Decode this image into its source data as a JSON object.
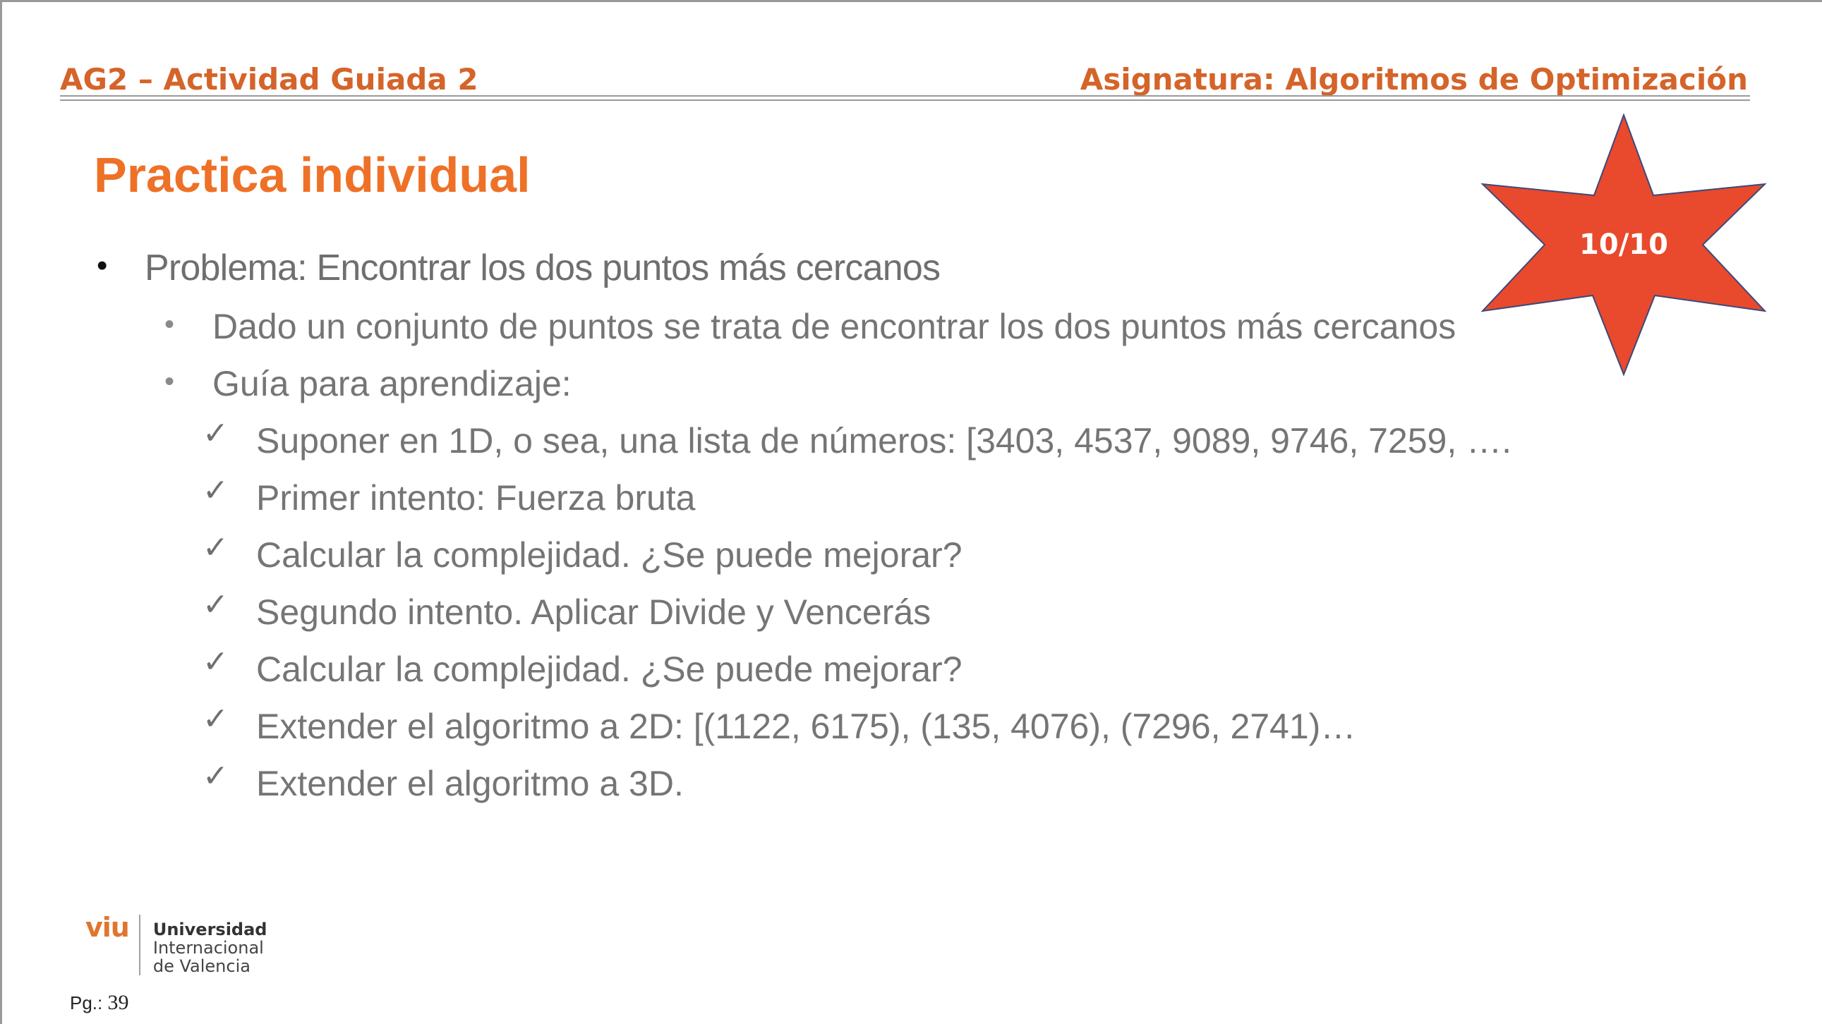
{
  "header": {
    "left": "AG2 – Actividad Guiada 2",
    "right": "Asignatura: Algoritmos de Optimización"
  },
  "title": "Practica individual",
  "badge": {
    "label": "10/10",
    "fill_color": "#e9492c",
    "stroke_color": "#3b4a7a"
  },
  "content": {
    "level1": {
      "bullet": "•",
      "text": "Problema: Encontrar los dos puntos más cercanos"
    },
    "level2": [
      {
        "bullet": "•",
        "text": "Dado un conjunto de puntos se trata de encontrar los dos puntos más cercanos"
      },
      {
        "bullet": "•",
        "text": "Guía para aprendizaje:"
      }
    ],
    "checks": [
      {
        "mark": "✓",
        "text": "Suponer en 1D, o sea, una lista de números: [3403, 4537, 9089, 9746, 7259, …."
      },
      {
        "mark": "✓",
        "text": "Primer intento: Fuerza bruta"
      },
      {
        "mark": "✓",
        "text": "Calcular la complejidad. ¿Se puede mejorar?"
      },
      {
        "mark": "✓",
        "text": "Segundo intento. Aplicar Divide y Vencerás"
      },
      {
        "mark": "✓",
        "text": "Calcular la complejidad. ¿Se puede mejorar?"
      },
      {
        "mark": "✓",
        "text": "Extender el algoritmo a 2D: [(1122, 6175), (135, 4076), (7296, 2741)…"
      },
      {
        "mark": "✓",
        "text": "Extender el algoritmo a 3D."
      }
    ]
  },
  "footer": {
    "logo_mark": "viu",
    "logo_line1": "Universidad",
    "logo_line2": "Internacional",
    "logo_line3": "de Valencia",
    "page_label": "Pg.:",
    "page_number": "39"
  },
  "colors": {
    "header": "#d4642a",
    "title": "#ee7127",
    "body_text": "#757575"
  }
}
